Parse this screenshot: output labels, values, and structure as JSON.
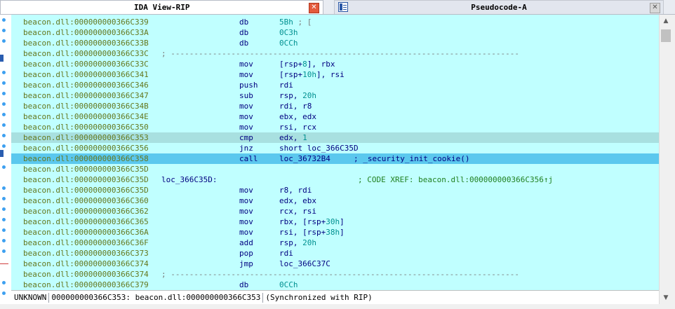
{
  "tabs": [
    {
      "title": "IDA View-RIP",
      "close_glyph": "✕",
      "icon": "close-red-icon"
    },
    {
      "title": "Pseudocode-A",
      "close_glyph": "✕",
      "icon": "close-gray-icon",
      "view_icon": "pseudocode-view-icon"
    }
  ],
  "scrollbar": {
    "up_glyph": "▲",
    "down_glyph": "▼"
  },
  "colors": {
    "background": "#c0ffff",
    "address": "#64781e",
    "instruction": "#000080",
    "number": "#009090",
    "comment": "#7a7a7a",
    "xref": "#208020",
    "current_line": "#5bc8ee",
    "selected_line": "#a8e0e0"
  },
  "lines": [
    {
      "addr": "beacon.dll:000000000366C339",
      "mn": "db",
      "op": "5Bh",
      "op_kind": "num",
      "comment": " ; ["
    },
    {
      "addr": "beacon.dll:000000000366C33A",
      "mn": "db",
      "op": "0C3h",
      "op_kind": "num"
    },
    {
      "addr": "beacon.dll:000000000366C33B",
      "mn": "db",
      "op": "0CCh",
      "op_kind": "num"
    },
    {
      "addr": "beacon.dll:000000000366C33C",
      "sep": "; ---------------------------------------------------------------------------"
    },
    {
      "addr": "beacon.dll:000000000366C33C",
      "mn": "mov",
      "op": "[rsp+8], rbx"
    },
    {
      "addr": "beacon.dll:000000000366C341",
      "mn": "mov",
      "op": "[rsp+10h], rsi"
    },
    {
      "addr": "beacon.dll:000000000366C346",
      "mn": "push",
      "op": "rdi"
    },
    {
      "addr": "beacon.dll:000000000366C347",
      "mn": "sub",
      "op": "rsp, 20h"
    },
    {
      "addr": "beacon.dll:000000000366C34B",
      "mn": "mov",
      "op": "rdi, r8"
    },
    {
      "addr": "beacon.dll:000000000366C34E",
      "mn": "mov",
      "op": "ebx, edx"
    },
    {
      "addr": "beacon.dll:000000000366C350",
      "mn": "mov",
      "op": "rsi, rcx"
    },
    {
      "addr": "beacon.dll:000000000366C353",
      "mn": "cmp",
      "op": "edx, 1",
      "hl": "gray"
    },
    {
      "addr": "beacon.dll:000000000366C356",
      "mn": "jnz",
      "op": "short loc_366C35D"
    },
    {
      "addr": "beacon.dll:000000000366C358",
      "mn": "call",
      "op": "loc_36732B4",
      "comment": "     ; _security_init_cookie()",
      "hl": "blue"
    },
    {
      "addr": "beacon.dll:000000000366C35D"
    },
    {
      "addr": "beacon.dll:000000000366C35D",
      "label": "loc_366C35D:",
      "xref": "; CODE XREF: beacon.dll:000000000366C356↑j"
    },
    {
      "addr": "beacon.dll:000000000366C35D",
      "mn": "mov",
      "op": "r8, rdi"
    },
    {
      "addr": "beacon.dll:000000000366C360",
      "mn": "mov",
      "op": "edx, ebx"
    },
    {
      "addr": "beacon.dll:000000000366C362",
      "mn": "mov",
      "op": "rcx, rsi"
    },
    {
      "addr": "beacon.dll:000000000366C365",
      "mn": "mov",
      "op": "rbx, [rsp+30h]"
    },
    {
      "addr": "beacon.dll:000000000366C36A",
      "mn": "mov",
      "op": "rsi, [rsp+38h]"
    },
    {
      "addr": "beacon.dll:000000000366C36F",
      "mn": "add",
      "op": "rsp, 20h"
    },
    {
      "addr": "beacon.dll:000000000366C373",
      "mn": "pop",
      "op": "rdi"
    },
    {
      "addr": "beacon.dll:000000000366C374",
      "mn": "jmp",
      "op": "loc_366C37C"
    },
    {
      "addr": "beacon.dll:000000000366C374",
      "sep": "; ---------------------------------------------------------------------------"
    },
    {
      "addr": "beacon.dll:000000000366C379",
      "mn": "db",
      "op": "0CCh",
      "op_kind": "num"
    }
  ],
  "status": {
    "mode": "UNKNOWN",
    "location": "000000000366C353: beacon.dll:000000000366C353",
    "sync": "(Synchronized with RIP)"
  }
}
